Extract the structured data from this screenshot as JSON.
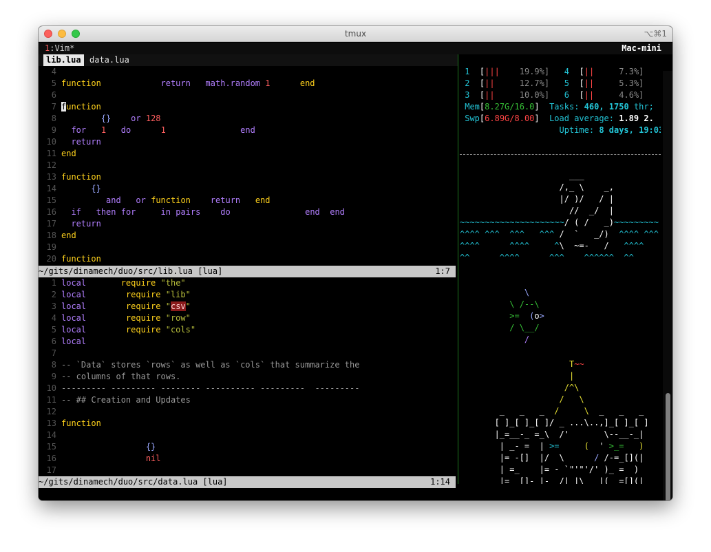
{
  "window": {
    "title": "tmux",
    "shortcut": "⌥⌘1"
  },
  "tmux": {
    "window_index": "1",
    "window_label": ":Vim*",
    "host": "Mac-mini"
  },
  "vim": {
    "tabs": [
      {
        "label": "lib.lua",
        "active": true
      },
      {
        "label": "data.lua",
        "active": false
      }
    ],
    "top_status": {
      "path": "~/gits/dinamech/duo/src/lib.lua [lua]",
      "pos": "1:7"
    },
    "bottom_status": {
      "path": "~/gits/dinamech/duo/src/data.lua [lua]",
      "pos": "1:14"
    }
  },
  "htop": {
    "cpus": [
      {
        "n": "1",
        "bar": "|||",
        "pct": "19.9%]"
      },
      {
        "n": "2",
        "bar": "||",
        "pct": "12.7%]"
      },
      {
        "n": "3",
        "bar": "||",
        "pct": "10.0%]"
      },
      {
        "n": "4",
        "bar": "||",
        "pct": "7.3%]"
      },
      {
        "n": "5",
        "bar": "||",
        "pct": "5.3%]"
      },
      {
        "n": "6",
        "bar": "||",
        "pct": "4.6%]"
      }
    ],
    "mem": "8.27G/16.0",
    "swp": "6.89G/8.00",
    "tasks_label": "Tasks:",
    "tasks": "460, 1750",
    "threads": "thr;",
    "load_label": "Load average:",
    "load": "1.89 2.",
    "uptime_label": "Uptime:",
    "uptime": "8 days, 19:03"
  },
  "colors": {
    "accent_green": "#1f7a1f",
    "keyword": "#ffd21c",
    "string": "#b9bf3c",
    "cyan": "#23c6d8"
  }
}
